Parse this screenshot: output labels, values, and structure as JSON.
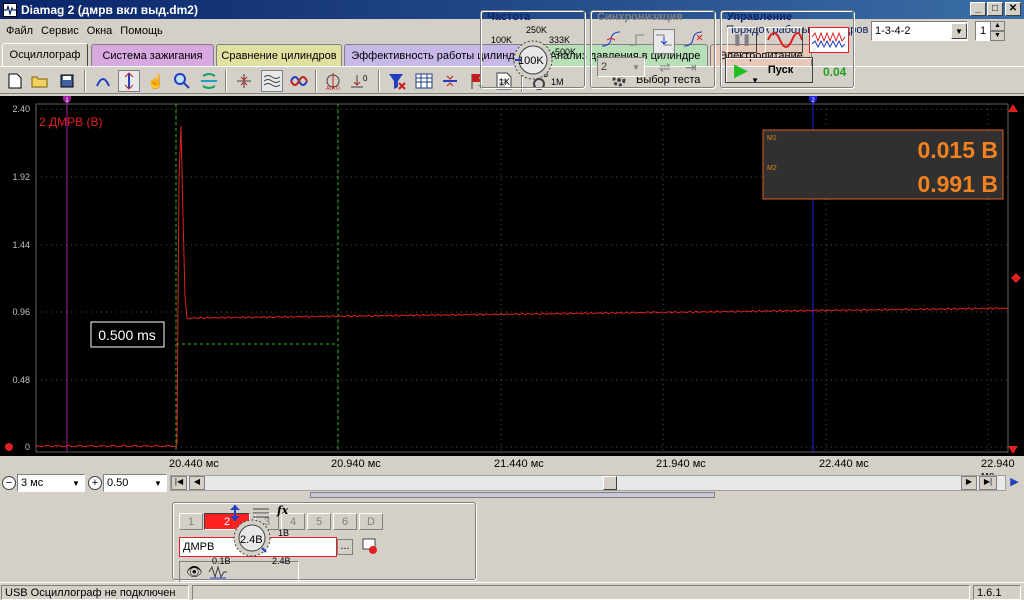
{
  "window": {
    "title": "Diamag 2 (дмрв вкл выд.dm2)",
    "min": "_",
    "max": "□",
    "close": "✕"
  },
  "menu": {
    "items": [
      "Файл",
      "Сервис",
      "Окна",
      "Помощь"
    ],
    "cylinder_order_label": "Порядок работы цилиндров",
    "cylinder_order_value": "1-3-4-2",
    "cylinder_count_value": "1"
  },
  "tabs": [
    {
      "label": "Осциллограф",
      "color": "#d4d0c8",
      "active": true
    },
    {
      "label": "Система зажигания",
      "color": "#d8a8e0"
    },
    {
      "label": "Сравнение цилиндров",
      "color": "#e0e0a0"
    },
    {
      "label": "Эффективность работы цилиндров",
      "color": "#c8b8e8"
    },
    {
      "label": "Анализ давления в цилиндре",
      "color": "#b8e0b8"
    },
    {
      "label": "Электропитание",
      "color": "#e8c8b8"
    }
  ],
  "toolbar": {
    "test_select_label": "Выбор теста"
  },
  "scope": {
    "y_ticks": [
      "2.40",
      "1.92",
      "1.44",
      "0.96",
      "0.48",
      "0"
    ],
    "channel_label": "2 ДМРВ (В)",
    "marker1_label": "1",
    "marker2_label": "2",
    "interval_label": "0.500 ms",
    "m1_label": "M1",
    "m2_label": "M2",
    "m1_value": "0.015 В",
    "m2_value": "0.991 В",
    "trace_color": "#e02020",
    "x_ticks": [
      "20.440 мс",
      "20.940 мс",
      "21.440 мс",
      "21.940 мс",
      "22.440 мс",
      "22.940 мс"
    ]
  },
  "controls": {
    "timebase": "3 мс",
    "scale": "0.50"
  },
  "channels": {
    "buttons": [
      "1",
      "2",
      "3",
      "4",
      "5",
      "6",
      "D"
    ],
    "active": "2",
    "sensor_name": "ДМРВ",
    "ellipsis": "...",
    "fx": "fx",
    "knob_value": "2.4В",
    "knob_min": "0.1В",
    "knob_1v": "1В",
    "knob_max": "2.4В"
  },
  "frequency": {
    "title": "Частота",
    "knob_value": "100K",
    "labels": [
      "250K",
      "333K",
      "100K",
      "500K",
      "1K",
      "1M"
    ]
  },
  "sync": {
    "title": "Синхронизация",
    "channel_value": "2"
  },
  "control": {
    "title": "Управление",
    "start_label": "Пуск",
    "value": "0.04"
  },
  "status": {
    "connection": "USB Осциллограф не подключен",
    "version": "1.6.1"
  }
}
